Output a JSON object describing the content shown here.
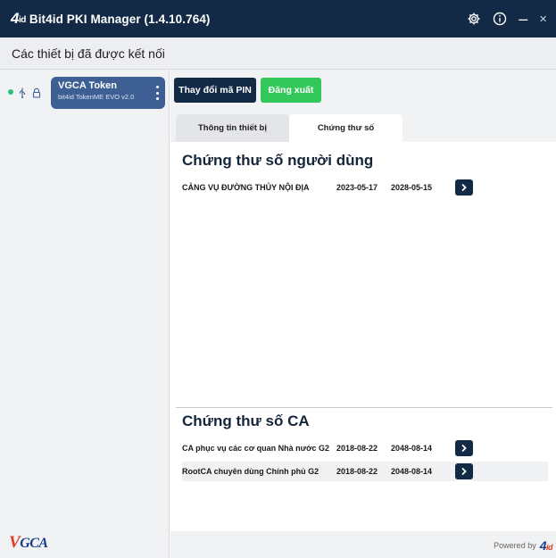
{
  "window": {
    "logo_number": "4",
    "logo_suffix": "id",
    "title": "Bit4id PKI Manager (1.4.10.764)",
    "icons": [
      "gear-icon",
      "info-icon",
      "minimize-icon",
      "close-icon"
    ],
    "minimize_glyph": "–",
    "close_glyph": "×"
  },
  "subheader": {
    "title": "Các thiết bị đã được kết nối"
  },
  "sidebar": {
    "device": {
      "name": "VGCA Token",
      "model": "bit4id TokenME EVO v2.0",
      "status_color": "#2ec27e"
    },
    "logo_v": "V",
    "logo_text": "GCA"
  },
  "toolbar": {
    "change_pin_label": "Thay đổi mã PIN",
    "logout_label": "Đăng xuất"
  },
  "tabs": [
    {
      "label": "Thông tin thiết bị",
      "active": false
    },
    {
      "label": "Chứng thư số",
      "active": true
    }
  ],
  "user_certs": {
    "title": "Chứng thư số người dùng",
    "rows": [
      {
        "name": "CẢNG VỤ ĐƯỜNG THỦY NỘI ĐỊA",
        "valid_from": "2023-05-17",
        "valid_to": "2028-05-15"
      }
    ]
  },
  "ca_certs": {
    "title": "Chứng thư số CA",
    "rows": [
      {
        "name": "CA phục vụ các cơ quan Nhà nước G2",
        "valid_from": "2018-08-22",
        "valid_to": "2048-08-14"
      },
      {
        "name": "RootCA chuyên dùng Chính phủ G2",
        "valid_from": "2018-08-22",
        "valid_to": "2048-08-14"
      }
    ]
  },
  "footer": {
    "powered_by": "Powered by",
    "brand_number": "4",
    "brand_suffix": "id"
  },
  "colors": {
    "titlebar": "#122a45",
    "token_card": "#3d5f93",
    "logout_button": "#34c759",
    "arrow_button": "#122a45"
  }
}
